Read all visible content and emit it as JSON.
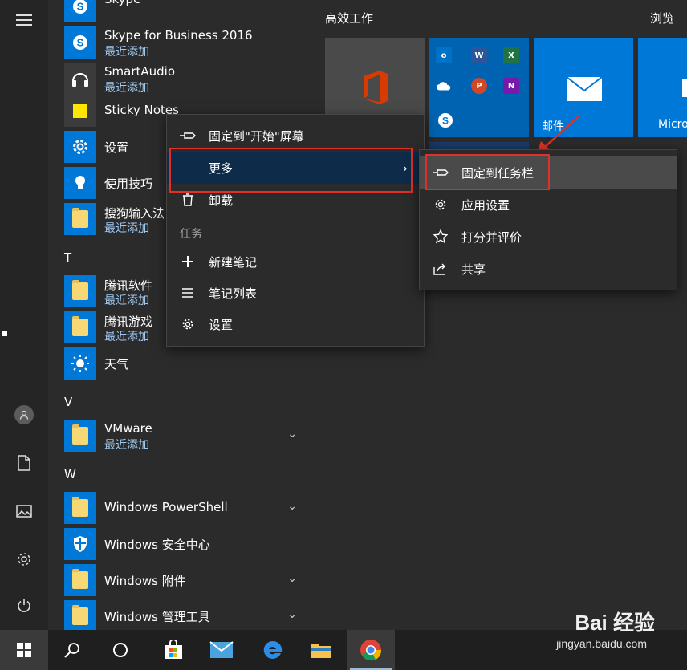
{
  "apps": [
    {
      "name": "Skype",
      "sub": ""
    },
    {
      "name": "Skype for Business 2016",
      "sub": "最近添加"
    },
    {
      "name": "SmartAudio",
      "sub": "最近添加"
    },
    {
      "name": "Sticky Notes",
      "sub": ""
    },
    {
      "name": "设置",
      "sub": ""
    },
    {
      "name": "使用技巧",
      "sub": ""
    },
    {
      "name": "搜狗输入法",
      "sub": "最近添加"
    },
    {
      "name": "腾讯软件",
      "sub": "最近添加"
    },
    {
      "name": "腾讯游戏",
      "sub": "最近添加"
    },
    {
      "name": "天气",
      "sub": ""
    },
    {
      "name": "VMware",
      "sub": "最近添加"
    },
    {
      "name": "Windows PowerShell",
      "sub": ""
    },
    {
      "name": "Windows 安全中心",
      "sub": ""
    },
    {
      "name": "Windows 附件",
      "sub": ""
    },
    {
      "name": "Windows 管理工具",
      "sub": ""
    }
  ],
  "letters": {
    "t": "T",
    "v": "V",
    "w": "W"
  },
  "tiles": {
    "group1": "高效工作",
    "group2": "浏览",
    "mail_label": "邮件",
    "store_label": "Micro",
    "mini_labels": {
      "outlook": "o",
      "word": "W",
      "excel": "X",
      "powerpoint": "P",
      "onenote": "N"
    }
  },
  "context_menu": {
    "pin_start": "固定到\"开始\"屏幕",
    "more": "更多",
    "uninstall": "卸载",
    "section_tasks": "任务",
    "new_note": "新建笔记",
    "note_list": "笔记列表",
    "settings": "设置"
  },
  "sub_menu": {
    "pin_taskbar": "固定到任务栏",
    "app_settings": "应用设置",
    "rate_review": "打分并评价",
    "share": "共享"
  },
  "watermark": {
    "brand": "Bai 经验",
    "url": "jingyan.baidu.com"
  },
  "colors": {
    "accent": "#0078d7",
    "highlight_box": "#e0302a",
    "recent_text": "#9fc9f0"
  }
}
